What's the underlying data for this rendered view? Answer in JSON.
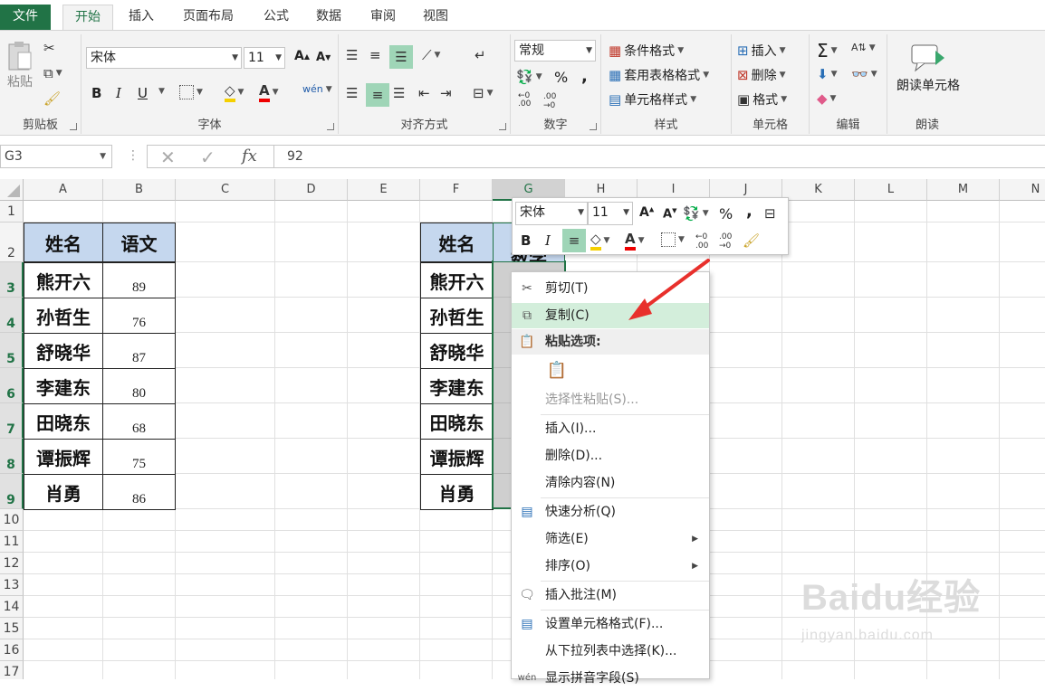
{
  "tabs": [
    "文件",
    "开始",
    "插入",
    "页面布局",
    "公式",
    "数据",
    "审阅",
    "视图"
  ],
  "clipboard": {
    "paste": "粘贴",
    "label": "剪贴板"
  },
  "font": {
    "name": "宋体",
    "size": "11",
    "label": "字体",
    "bold": "B",
    "italic": "I",
    "underline": "U",
    "grow": "A",
    "shrink": "A"
  },
  "align": {
    "label": "对齐方式"
  },
  "number": {
    "format": "常规",
    "label": "数字",
    "percent": "%",
    "comma": ","
  },
  "styles": {
    "cond": "条件格式",
    "table": "套用表格格式",
    "cell": "单元格样式",
    "label": "样式"
  },
  "cells": {
    "insert": "插入",
    "delete": "删除",
    "format": "格式",
    "label": "单元格"
  },
  "edit": {
    "label": "编辑",
    "sum": "Σ"
  },
  "read": {
    "button": "朗读单元格",
    "label": "朗读"
  },
  "formula_bar": {
    "name_box": "G3",
    "fx": "fx",
    "value": "92"
  },
  "columns": [
    "A",
    "B",
    "C",
    "D",
    "E",
    "F",
    "G",
    "H",
    "I",
    "J",
    "K",
    "L",
    "M",
    "N"
  ],
  "rows": [
    "1",
    "2",
    "3",
    "4",
    "5",
    "6",
    "7",
    "8",
    "9",
    "10",
    "11",
    "12",
    "13",
    "14",
    "15",
    "16",
    "17"
  ],
  "table1": {
    "headers": [
      "姓名",
      "语文"
    ],
    "names": [
      "熊开六",
      "孙哲生",
      "舒晓华",
      "李建东",
      "田晓东",
      "谭振辉",
      "肖勇"
    ],
    "scores": [
      "89",
      "76",
      "87",
      "80",
      "68",
      "75",
      "86"
    ]
  },
  "table2": {
    "header": "姓名",
    "header2": "数学",
    "names": [
      "熊开六",
      "孙哲生",
      "舒晓华",
      "李建东",
      "田晓东",
      "谭振辉",
      "肖勇"
    ]
  },
  "mini_toolbar": {
    "font": "宋体",
    "size": "11",
    "percent": "%",
    "comma": ",",
    "bold": "B",
    "italic": "I"
  },
  "context_menu": {
    "cut": "剪切(T)",
    "copy": "复制(C)",
    "paste_options": "粘贴选项:",
    "paste_special": "选择性粘贴(S)...",
    "insert": "插入(I)...",
    "delete": "删除(D)...",
    "clear": "清除内容(N)",
    "quick": "快速分析(Q)",
    "filter": "筛选(E)",
    "sort": "排序(O)",
    "comment": "插入批注(M)",
    "format": "设置单元格格式(F)...",
    "pick": "从下拉列表中选择(K)...",
    "phonetic": "显示拼音字段(S)"
  },
  "watermark": {
    "brand": "Baidu经验",
    "url": "jingyan.baidu.com"
  },
  "colors": {
    "accent": "#217346",
    "header_fill": "#c5d7ee",
    "highlight": "#9fd5b7",
    "arrow": "#e8302c"
  }
}
